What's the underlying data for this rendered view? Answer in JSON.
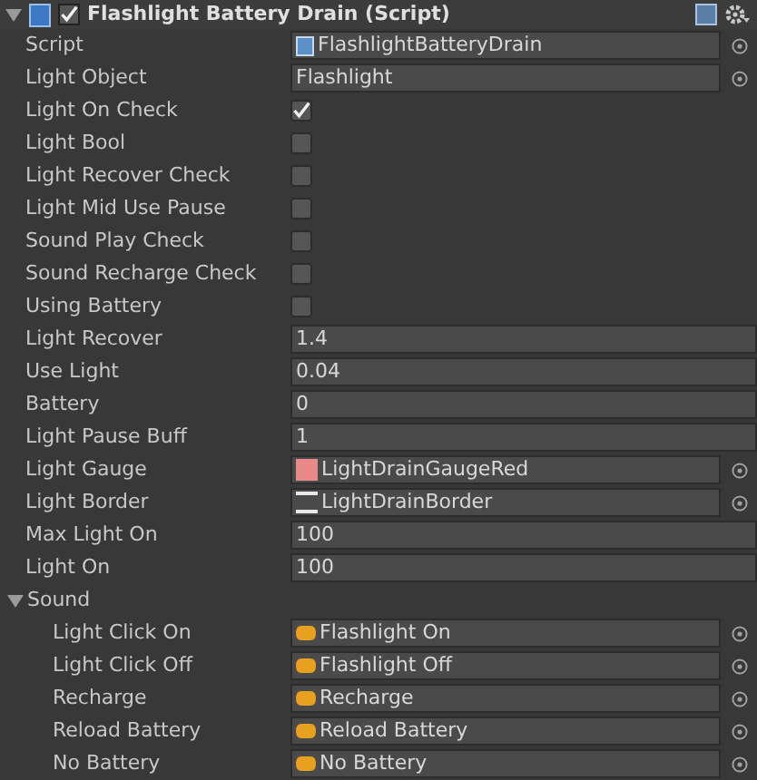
{
  "header": {
    "expanded": true,
    "enabled": true,
    "title": "Flashlight Battery Drain (Script)"
  },
  "fields": [
    {
      "kind": "script",
      "label": "Script",
      "value": "FlashlightBatteryDrain"
    },
    {
      "kind": "object",
      "label": "Light Object",
      "value": "Flashlight"
    },
    {
      "kind": "toggle",
      "label": "Light On Check",
      "checked": true
    },
    {
      "kind": "toggle",
      "label": "Light Bool",
      "checked": false
    },
    {
      "kind": "toggle",
      "label": "Light Recover Check",
      "checked": false
    },
    {
      "kind": "toggle",
      "label": "Light Mid Use Pause",
      "checked": false
    },
    {
      "kind": "toggle",
      "label": "Sound Play Check",
      "checked": false
    },
    {
      "kind": "toggle",
      "label": "Sound Recharge Check",
      "checked": false
    },
    {
      "kind": "toggle",
      "label": "Using Battery",
      "checked": false
    },
    {
      "kind": "number",
      "label": "Light Recover",
      "value": "1.4"
    },
    {
      "kind": "number",
      "label": "Use Light",
      "value": "0.04"
    },
    {
      "kind": "number",
      "label": "Battery",
      "value": "0"
    },
    {
      "kind": "number",
      "label": "Light Pause Buff",
      "value": "1"
    },
    {
      "kind": "texture",
      "label": "Light Gauge",
      "value": "LightDrainGaugeRed"
    },
    {
      "kind": "sprite",
      "label": "Light Border",
      "value": "LightDrainBorder"
    },
    {
      "kind": "number",
      "label": "Max Light On",
      "value": "100"
    },
    {
      "kind": "number",
      "label": "Light On",
      "value": "100"
    },
    {
      "kind": "foldout",
      "label": "Sound",
      "expanded": true,
      "children": [
        {
          "kind": "audio",
          "label": "Light Click On",
          "value": "Flashlight On"
        },
        {
          "kind": "audio",
          "label": "Light Click Off",
          "value": "Flashlight Off"
        },
        {
          "kind": "audio",
          "label": "Recharge",
          "value": "Recharge"
        },
        {
          "kind": "audio",
          "label": "Reload Battery",
          "value": "Reload Battery"
        },
        {
          "kind": "audio",
          "label": "No Battery",
          "value": "No Battery"
        }
      ]
    }
  ]
}
